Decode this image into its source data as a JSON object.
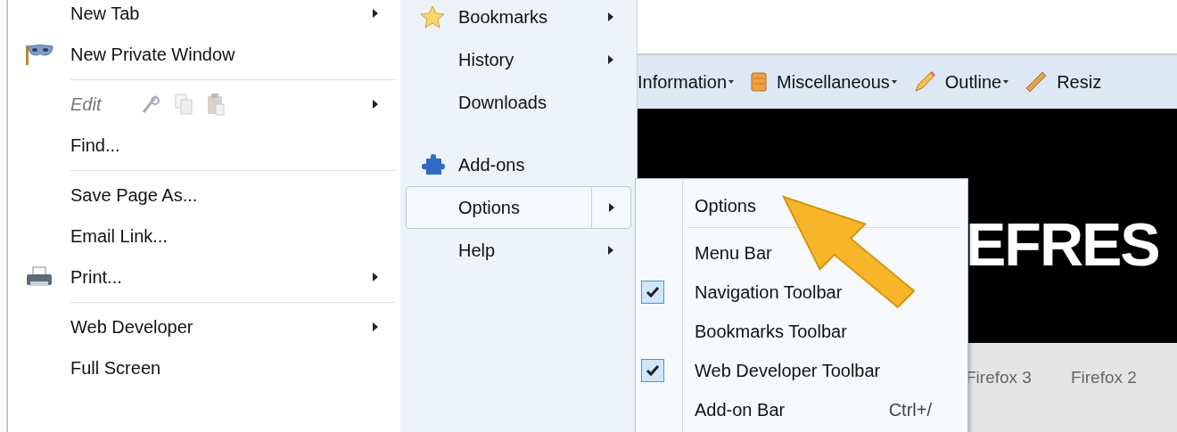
{
  "main_menu": {
    "items": [
      {
        "kind": "item",
        "label": "New Tab",
        "submenu": true,
        "disabled": false
      },
      {
        "kind": "item",
        "label": "New Private Window",
        "submenu": false,
        "disabled": false
      },
      {
        "kind": "separator"
      },
      {
        "kind": "edit",
        "label": "Edit",
        "submenu": true,
        "disabled": true
      },
      {
        "kind": "item",
        "label": "Find...",
        "submenu": false,
        "disabled": false
      },
      {
        "kind": "separator"
      },
      {
        "kind": "item",
        "label": "Save Page As...",
        "submenu": false,
        "disabled": false
      },
      {
        "kind": "item",
        "label": "Email Link...",
        "submenu": false,
        "disabled": false
      },
      {
        "kind": "item",
        "label": "Print...",
        "submenu": true,
        "disabled": false
      },
      {
        "kind": "separator"
      },
      {
        "kind": "item",
        "label": "Web Developer",
        "submenu": true,
        "disabled": false
      },
      {
        "kind": "item",
        "label": "Full Screen",
        "submenu": false,
        "disabled": false
      }
    ]
  },
  "side_menu": {
    "items": [
      {
        "kind": "item",
        "label": "Bookmarks",
        "submenu": true,
        "selected": false
      },
      {
        "kind": "item",
        "label": "History",
        "submenu": true,
        "selected": false
      },
      {
        "kind": "item",
        "label": "Downloads",
        "submenu": false,
        "selected": false
      },
      {
        "kind": "gap"
      },
      {
        "kind": "item",
        "label": "Add-ons",
        "submenu": false,
        "selected": false
      },
      {
        "kind": "item",
        "label": "Options",
        "submenu": true,
        "selected": true
      },
      {
        "kind": "item",
        "label": "Help",
        "submenu": true,
        "selected": false
      }
    ]
  },
  "options_submenu": {
    "items": [
      {
        "kind": "item",
        "label": "Options"
      },
      {
        "kind": "separator"
      },
      {
        "kind": "toggle",
        "label": "Menu Bar",
        "checked": false
      },
      {
        "kind": "toggle",
        "label": "Navigation Toolbar",
        "checked": true
      },
      {
        "kind": "toggle",
        "label": "Bookmarks Toolbar",
        "checked": false
      },
      {
        "kind": "toggle",
        "label": "Web Developer Toolbar",
        "checked": true
      },
      {
        "kind": "toggle",
        "label": "Add-on Bar",
        "shortcut": "Ctrl+/",
        "checked": false
      }
    ]
  },
  "toolbar": {
    "items": [
      {
        "label": "Information",
        "dropdown": true
      },
      {
        "label": "Miscellaneous",
        "dropdown": true
      },
      {
        "label": "Outline",
        "dropdown": true
      },
      {
        "label": "Resiz",
        "dropdown": false
      }
    ]
  },
  "page": {
    "banner_text": "EFRES",
    "tabs": [
      "Firefox 3",
      "Firefox 2"
    ]
  }
}
